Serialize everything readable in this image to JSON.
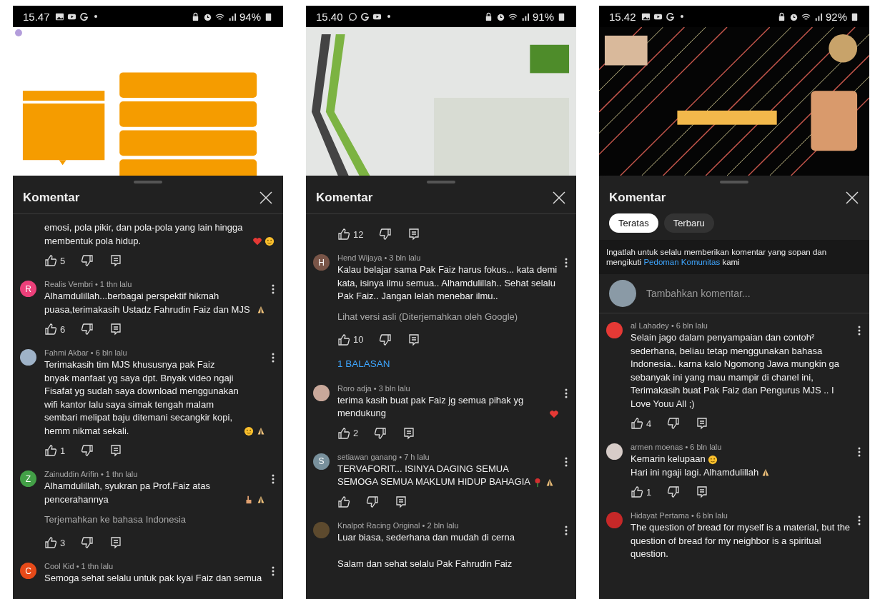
{
  "phones": [
    {
      "status": {
        "time": "15.47",
        "icons": [
          {
            "kind": "image"
          },
          {
            "kind": "youtube"
          },
          {
            "kind": "g"
          },
          {
            "kind": "dot"
          }
        ],
        "battery": "94%"
      },
      "video": {
        "kind": "orange-slide"
      },
      "sheet": {
        "title": "Komentar",
        "comments": [
          {
            "lines": [
              {
                "text": "emosi, pola pikir, dan pola-pola yang lain hingga membentuk pola hidup.",
                "emojis": [
                  {
                    "kind": "heart"
                  },
                  {
                    "kind": "face"
                  }
                ]
              }
            ],
            "actions": true,
            "likes": "5"
          },
          {
            "avatar": {
              "kind": "letter",
              "letter": "R",
              "color": "#ec407a"
            },
            "meta": "Realis Vembri • 1 thn lalu",
            "lines": [
              {
                "text": "Alhamdulillah...berbagai perspektif hikmah puasa,terimakasih Ustadz Fahrudin Faiz dan MJS",
                "emojis": [
                  {
                    "kind": "pray"
                  }
                ]
              }
            ],
            "actions": true,
            "likes": "6"
          },
          {
            "avatar": {
              "kind": "photo",
              "color": "#9fb3c8"
            },
            "meta": "Fahmi Akbar • 6 bln lalu",
            "lines": [
              {
                "text": "Terimakasih tim MJS khususnya pak Faiz bnyak manfaat yg saya dpt. Bnyak video ngaji Fisafat yg sudah saya download menggunakan wifi kantor lalu saya simak tengah malam sembari melipat baju ditemani secangkir kopi, hemm nikmat sekali.",
                "emojis": [
                  {
                    "kind": "face"
                  },
                  {
                    "kind": "pray"
                  }
                ]
              }
            ],
            "actions": true,
            "likes": "1"
          },
          {
            "avatar": {
              "kind": "letter",
              "letter": "Z",
              "color": "#43a047"
            },
            "meta": "Zainuddin Arifin • 1 thn lalu",
            "lines": [
              {
                "text": "Alhamdulillah, syukran pa Prof.Faiz atas pencerahannya",
                "emojis": [
                  {
                    "kind": "hand"
                  },
                  {
                    "kind": "pray"
                  }
                ]
              }
            ],
            "translate": "Terjemahkan ke bahasa Indonesia",
            "actions": true,
            "likes": "3"
          },
          {
            "avatar": {
              "kind": "letter",
              "letter": "C",
              "color": "#e64a19"
            },
            "meta": "Cool Kid • 1 thn lalu",
            "lines": [
              {
                "text": "Semoga sehat selalu untuk pak kyai Faiz dan semua"
              }
            ],
            "actions": false
          }
        ]
      }
    },
    {
      "status": {
        "time": "15.40",
        "icons": [
          {
            "kind": "chat"
          },
          {
            "kind": "g"
          },
          {
            "kind": "youtube"
          },
          {
            "kind": "dot"
          }
        ],
        "battery": "91%"
      },
      "video": {
        "kind": "green-slide"
      },
      "sheet": {
        "title": "Komentar",
        "comments": [
          {
            "actions": true,
            "likes": "12"
          },
          {
            "avatar": {
              "kind": "letter",
              "letter": "H",
              "color": "#795548"
            },
            "meta": "Hend Wijaya • 3 bln lalu",
            "lines": [
              {
                "text": "Kalau belajar sama Pak Faiz harus fokus... kata demi kata, isinya ilmu semua.. Alhamdulillah.. Sehat selalu Pak Faiz.. Jangan lelah menebar ilmu.."
              }
            ],
            "translate": "Lihat versi asli (Diterjemahkan oleh Google)",
            "actions": true,
            "likes": "10",
            "replies": "1 BALASAN"
          },
          {
            "avatar": {
              "kind": "photo",
              "color": "#c9a89a"
            },
            "meta": "Roro adja • 3 bln lalu",
            "lines": [
              {
                "text": "terima kasih buat pak Faiz jg semua pihak yg mendukung",
                "emojis": [
                  {
                    "kind": "heart"
                  }
                ]
              }
            ],
            "actions": true,
            "likes": "2"
          },
          {
            "avatar": {
              "kind": "letter",
              "letter": "S",
              "color": "#78909c"
            },
            "meta": "setiawan ganang • 7 h lalu",
            "lines": [
              {
                "text": "TERVAFORIT... ISINYA DAGING SEMUA\nSEMOGA SEMUA MAKLUM HIDUP BAHAGIA",
                "emojis": [
                  {
                    "kind": "rose"
                  },
                  {
                    "kind": "pray"
                  }
                ]
              }
            ],
            "actions": true
          },
          {
            "avatar": {
              "kind": "photo",
              "color": "#5d4a2e"
            },
            "meta": "Knalpot Racing Original • 2 bln lalu",
            "lines": [
              {
                "text": "Luar biasa, sederhana dan mudah di cerna\n\nSalam dan sehat selalu Pak Fahrudin Faiz"
              }
            ],
            "actions": false
          }
        ]
      }
    },
    {
      "status": {
        "time": "15.42",
        "icons": [
          {
            "kind": "image"
          },
          {
            "kind": "youtube"
          },
          {
            "kind": "g"
          },
          {
            "kind": "dot"
          }
        ],
        "battery": "92%"
      },
      "video": {
        "kind": "dark-slide"
      },
      "sheet": {
        "title": "Komentar",
        "filters": [
          {
            "label": "Teratas",
            "selected": true
          },
          {
            "label": "Terbaru",
            "selected": false
          }
        ],
        "notice": {
          "text": "Ingatlah untuk selalu memberikan komentar yang sopan dan mengikuti",
          "link": "Pedoman Komunitas",
          "after": "kami"
        },
        "composer": {
          "placeholder": "Tambahkan komentar..."
        },
        "comments": [
          {
            "avatar": {
              "kind": "photo",
              "color": "#e53935"
            },
            "meta": "al Lahadey • 6 bln lalu",
            "lines": [
              {
                "text": "Selain jago dalam penyampaian dan contoh² sederhana, beliau tetap menggunakan bahasa Indonesia.. karna kalo Ngomong Jawa mungkin ga sebanyak ini yang mau mampir di chanel ini, Terimakasih buat Pak Faiz dan Pengurus MJS .. I Love Youu All ;)"
              }
            ],
            "actions": true,
            "likes": "4"
          },
          {
            "avatar": {
              "kind": "photo",
              "color": "#d7ccc8"
            },
            "meta": "armen moenas • 6 bln lalu",
            "lines": [
              {
                "text": "Kemarin kelupaan",
                "emojis": [
                  {
                    "kind": "smile"
                  }
                ]
              },
              {
                "text": "Hari ini ngaji lagi. Alhamdulillah",
                "emojis": [
                  {
                    "kind": "pray"
                  }
                ]
              }
            ],
            "actions": true,
            "likes": "1"
          },
          {
            "avatar": {
              "kind": "photo",
              "color": "#c62828"
            },
            "meta": "Hidayat Pertama • 6 bln lalu",
            "lines": [
              {
                "text": "The question of bread for myself is a material, but the question of bread for my neighbor is a spiritual question."
              }
            ],
            "actions": false
          }
        ]
      }
    }
  ]
}
